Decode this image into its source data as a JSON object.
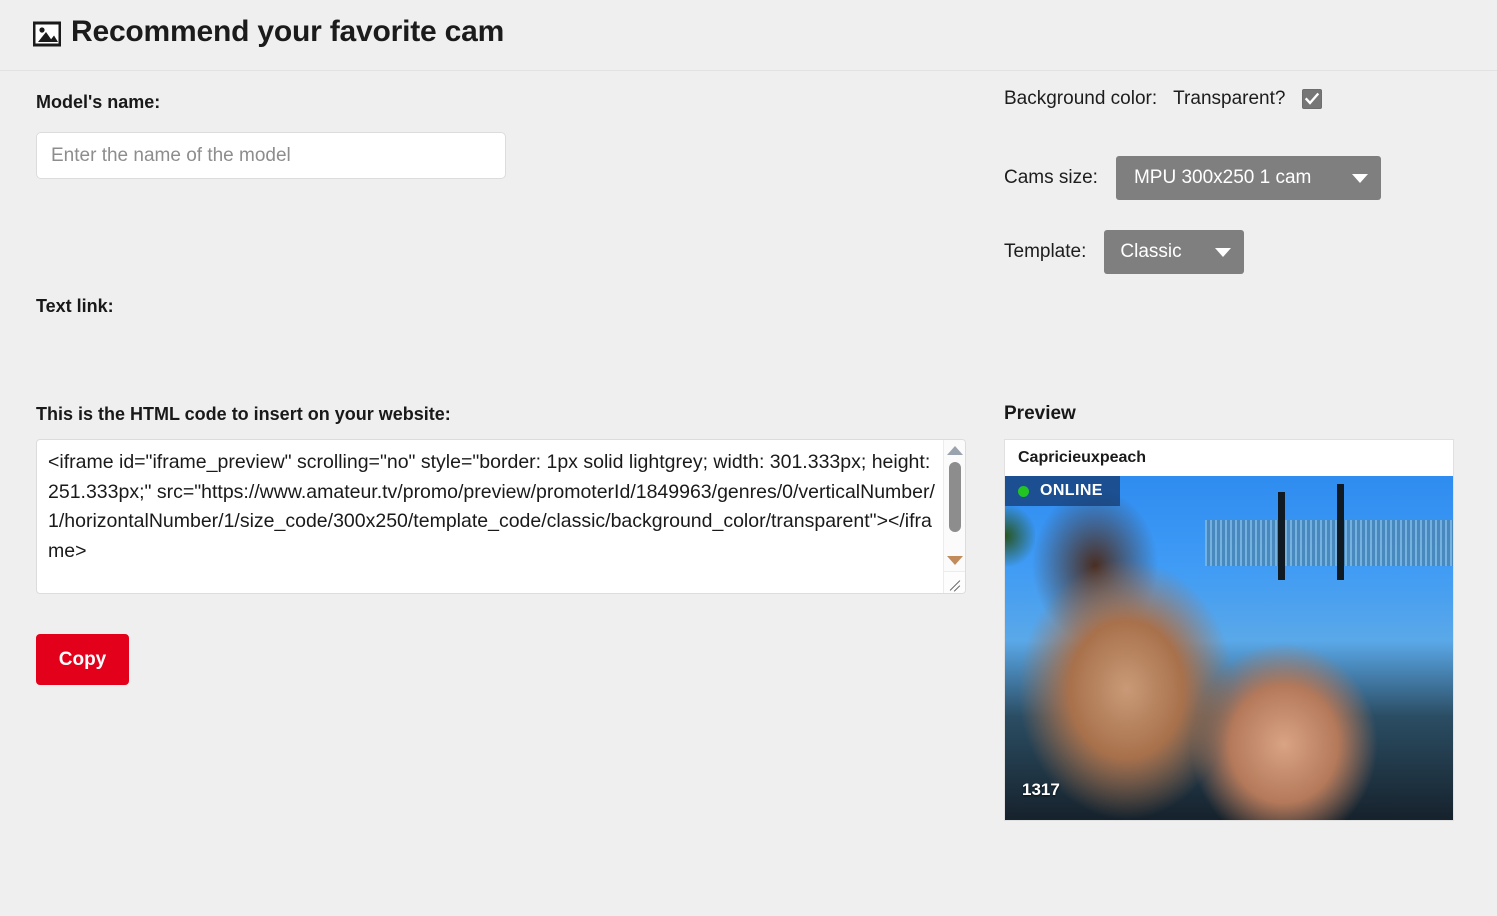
{
  "header": {
    "icon": "image-icon",
    "title": "Recommend your favorite cam"
  },
  "form": {
    "model_name_label": "Model's name:",
    "model_name_value": "",
    "model_name_placeholder": "Enter the name of the model",
    "text_link_label": "Text link:",
    "text_link_value": "",
    "html_code_label": "This is the HTML code to insert on your website:",
    "html_code_value": "<iframe id=\"iframe_preview\" scrolling=\"no\" style=\"border: 1px solid lightgrey; width: 301.333px; height: 251.333px;\" src=\"https://www.amateur.tv/promo/preview/promoterId/1849963/genres/0/verticalNumber/1/horizontalNumber/1/size_code/300x250/template_code/classic/background_color/transparent\"></iframe>",
    "copy_button_label": "Copy"
  },
  "options": {
    "background_color_label": "Background color:",
    "transparent_label": "Transparent?",
    "transparent_checked": true,
    "cams_size_label": "Cams size:",
    "cams_size_value": "MPU 300x250 1 cam",
    "template_label": "Template:",
    "template_value": "Classic"
  },
  "preview": {
    "heading": "Preview",
    "model_name": "Capricieuxpeach",
    "status_text": "ONLINE",
    "status_dot_color": "#22c422",
    "viewer_count": "1317"
  },
  "colors": {
    "page_background": "#efefef",
    "copy_button": "#e3001b",
    "select_background": "#7f7f7f",
    "checkbox_background": "#767676"
  }
}
